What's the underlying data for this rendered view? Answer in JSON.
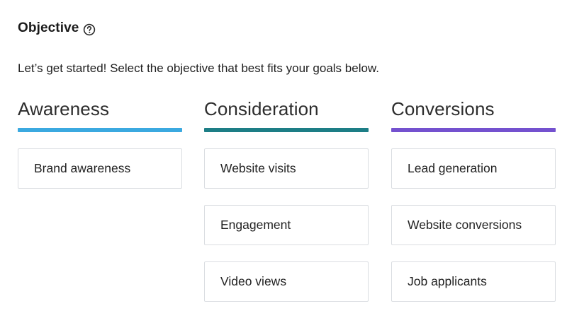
{
  "header": {
    "title": "Objective",
    "help_icon": "question-circle-icon"
  },
  "subtitle": "Let’s get started! Select the objective that best fits your goals below.",
  "columns": [
    {
      "heading": "Awareness",
      "color": "#3ba9e0",
      "options": [
        "Brand awareness"
      ]
    },
    {
      "heading": "Consideration",
      "color": "#1d7e86",
      "options": [
        "Website visits",
        "Engagement",
        "Video views"
      ]
    },
    {
      "heading": "Conversions",
      "color": "#7451cf",
      "options": [
        "Lead generation",
        "Website conversions",
        "Job applicants"
      ]
    }
  ]
}
